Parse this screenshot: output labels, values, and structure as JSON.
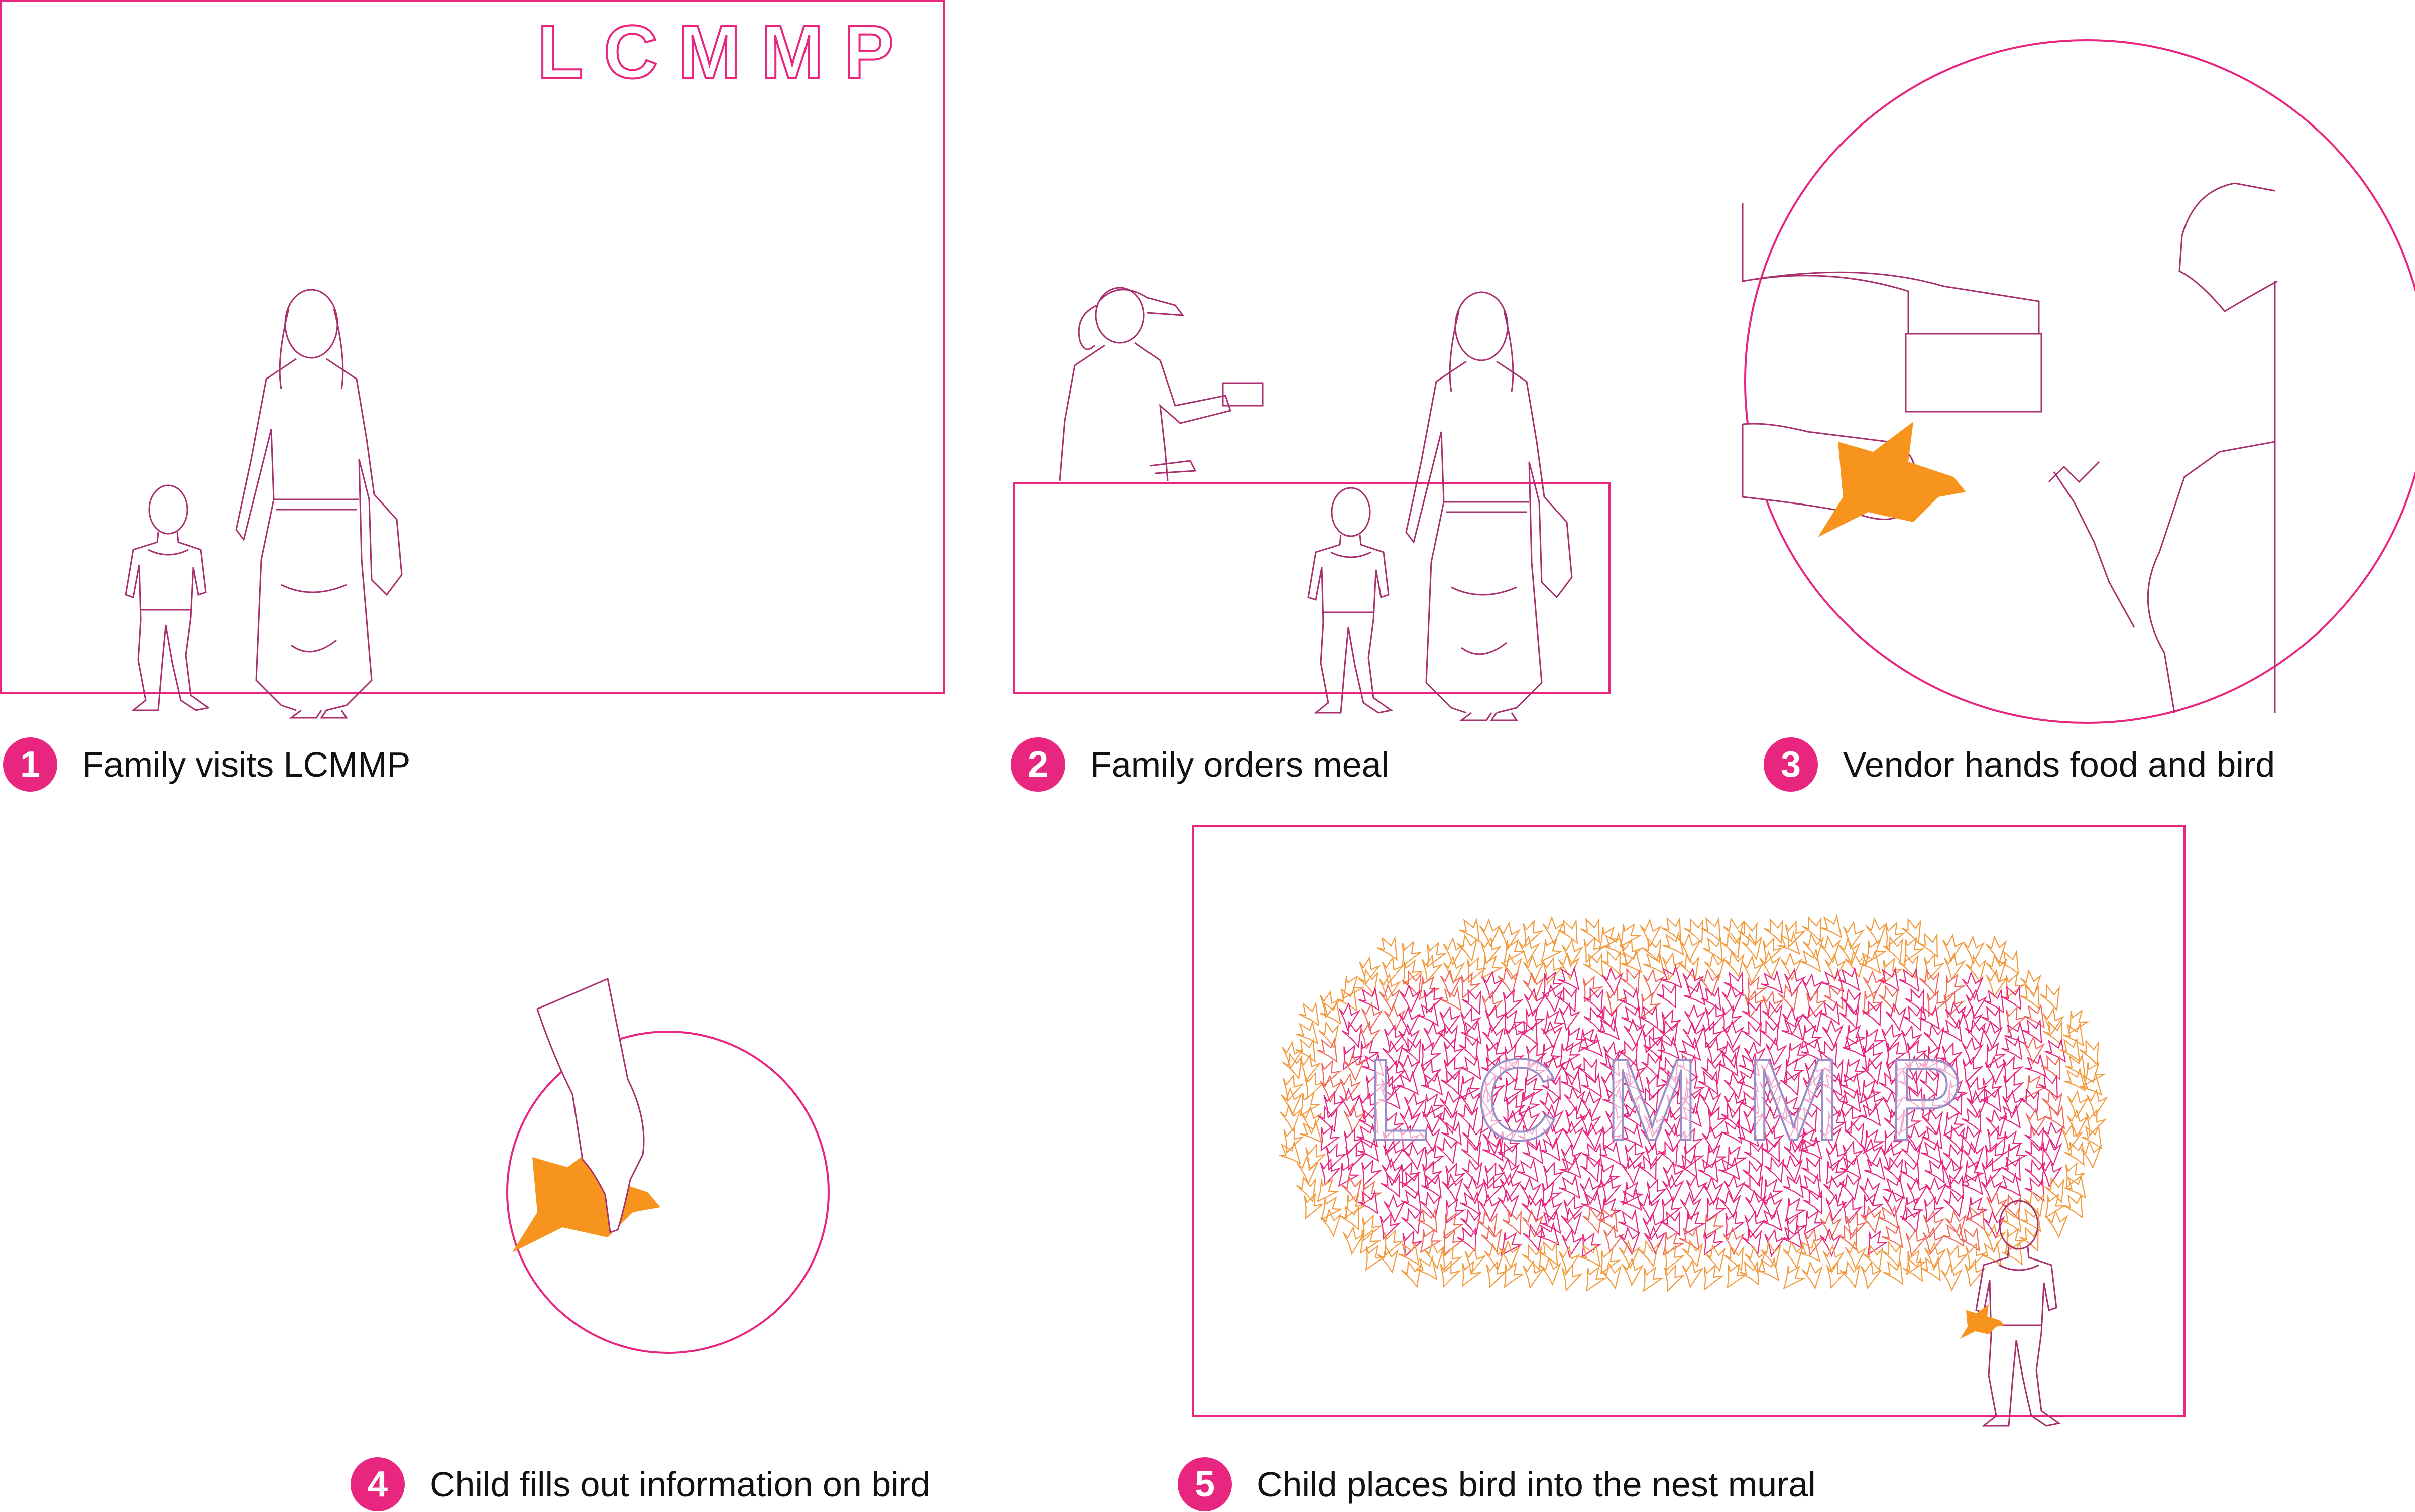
{
  "colors": {
    "accent": "#e8267f",
    "figure_line": "#a8306e",
    "bird": "#f7941d",
    "mural_warm": "#f29a3e",
    "mural_mid": "#e8267f",
    "logo_in_mural": "#9a8fc8"
  },
  "panels": {
    "panel1": {
      "sign_text": "LCMMP"
    },
    "panel5": {
      "mural_text": "LCMMP"
    }
  },
  "steps": [
    {
      "number": "1",
      "label": "Family visits LCMMP"
    },
    {
      "number": "2",
      "label": "Family orders meal"
    },
    {
      "number": "3",
      "label": "Vendor hands food and bird"
    },
    {
      "number": "4",
      "label": "Child fills out information on bird"
    },
    {
      "number": "5",
      "label": "Child places bird into the nest mural"
    }
  ]
}
